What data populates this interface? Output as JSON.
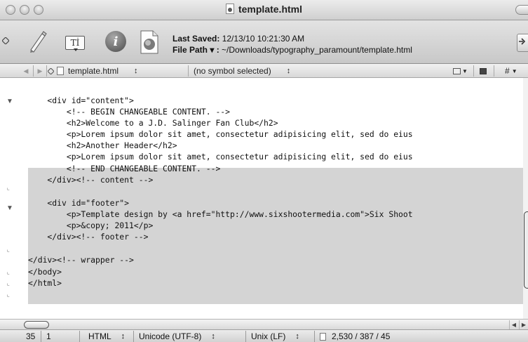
{
  "window": {
    "title": "template.html"
  },
  "toolbar": {
    "last_saved_label": "Last Saved:",
    "last_saved_value": "12/13/10 10:21:30 AM",
    "file_path_label": "File Path ▾ :",
    "file_path_value": "~/Downloads/typography_paramount/template.html",
    "text_options_glyph": "Tİ"
  },
  "navbar": {
    "file_name": "template.html",
    "symbol": "(no symbol selected)",
    "updown_glyph": "↕",
    "hash_glyph": "#"
  },
  "code_lines": [
    "",
    "    <div id=\"content\">",
    "        <!-- BEGIN CHANGEABLE CONTENT. -->",
    "        <h2>Welcome to a J.D. Salinger Fan Club</h2>",
    "        <p>Lorem ipsum dolor sit amet, consectetur adipisicing elit, sed do eius",
    "        <h2>Another Header</h2>",
    "        <p>Lorem ipsum dolor sit amet, consectetur adipisicing elit, sed do eius",
    "        <!-- END CHANGEABLE CONTENT. -->",
    "    </div><!-- content -->",
    "",
    "    <div id=\"footer\">",
    "        <p>Template design by <a href=\"http://www.sixshootermedia.com\">Six Shoot",
    "        <p>&copy; 2011</p>",
    "    </div><!-- footer -->",
    "",
    "</div><!-- wrapper -->",
    "</body>",
    "</html>"
  ],
  "status": {
    "line": "35",
    "column": "1",
    "language": "HTML",
    "encoding": "Unicode (UTF-8)",
    "line_endings": "Unix (LF)",
    "counts": "2,530 / 387 / 45"
  },
  "colors": {
    "selection": "#d4d4d4",
    "chrome": "#d6d6d6"
  }
}
